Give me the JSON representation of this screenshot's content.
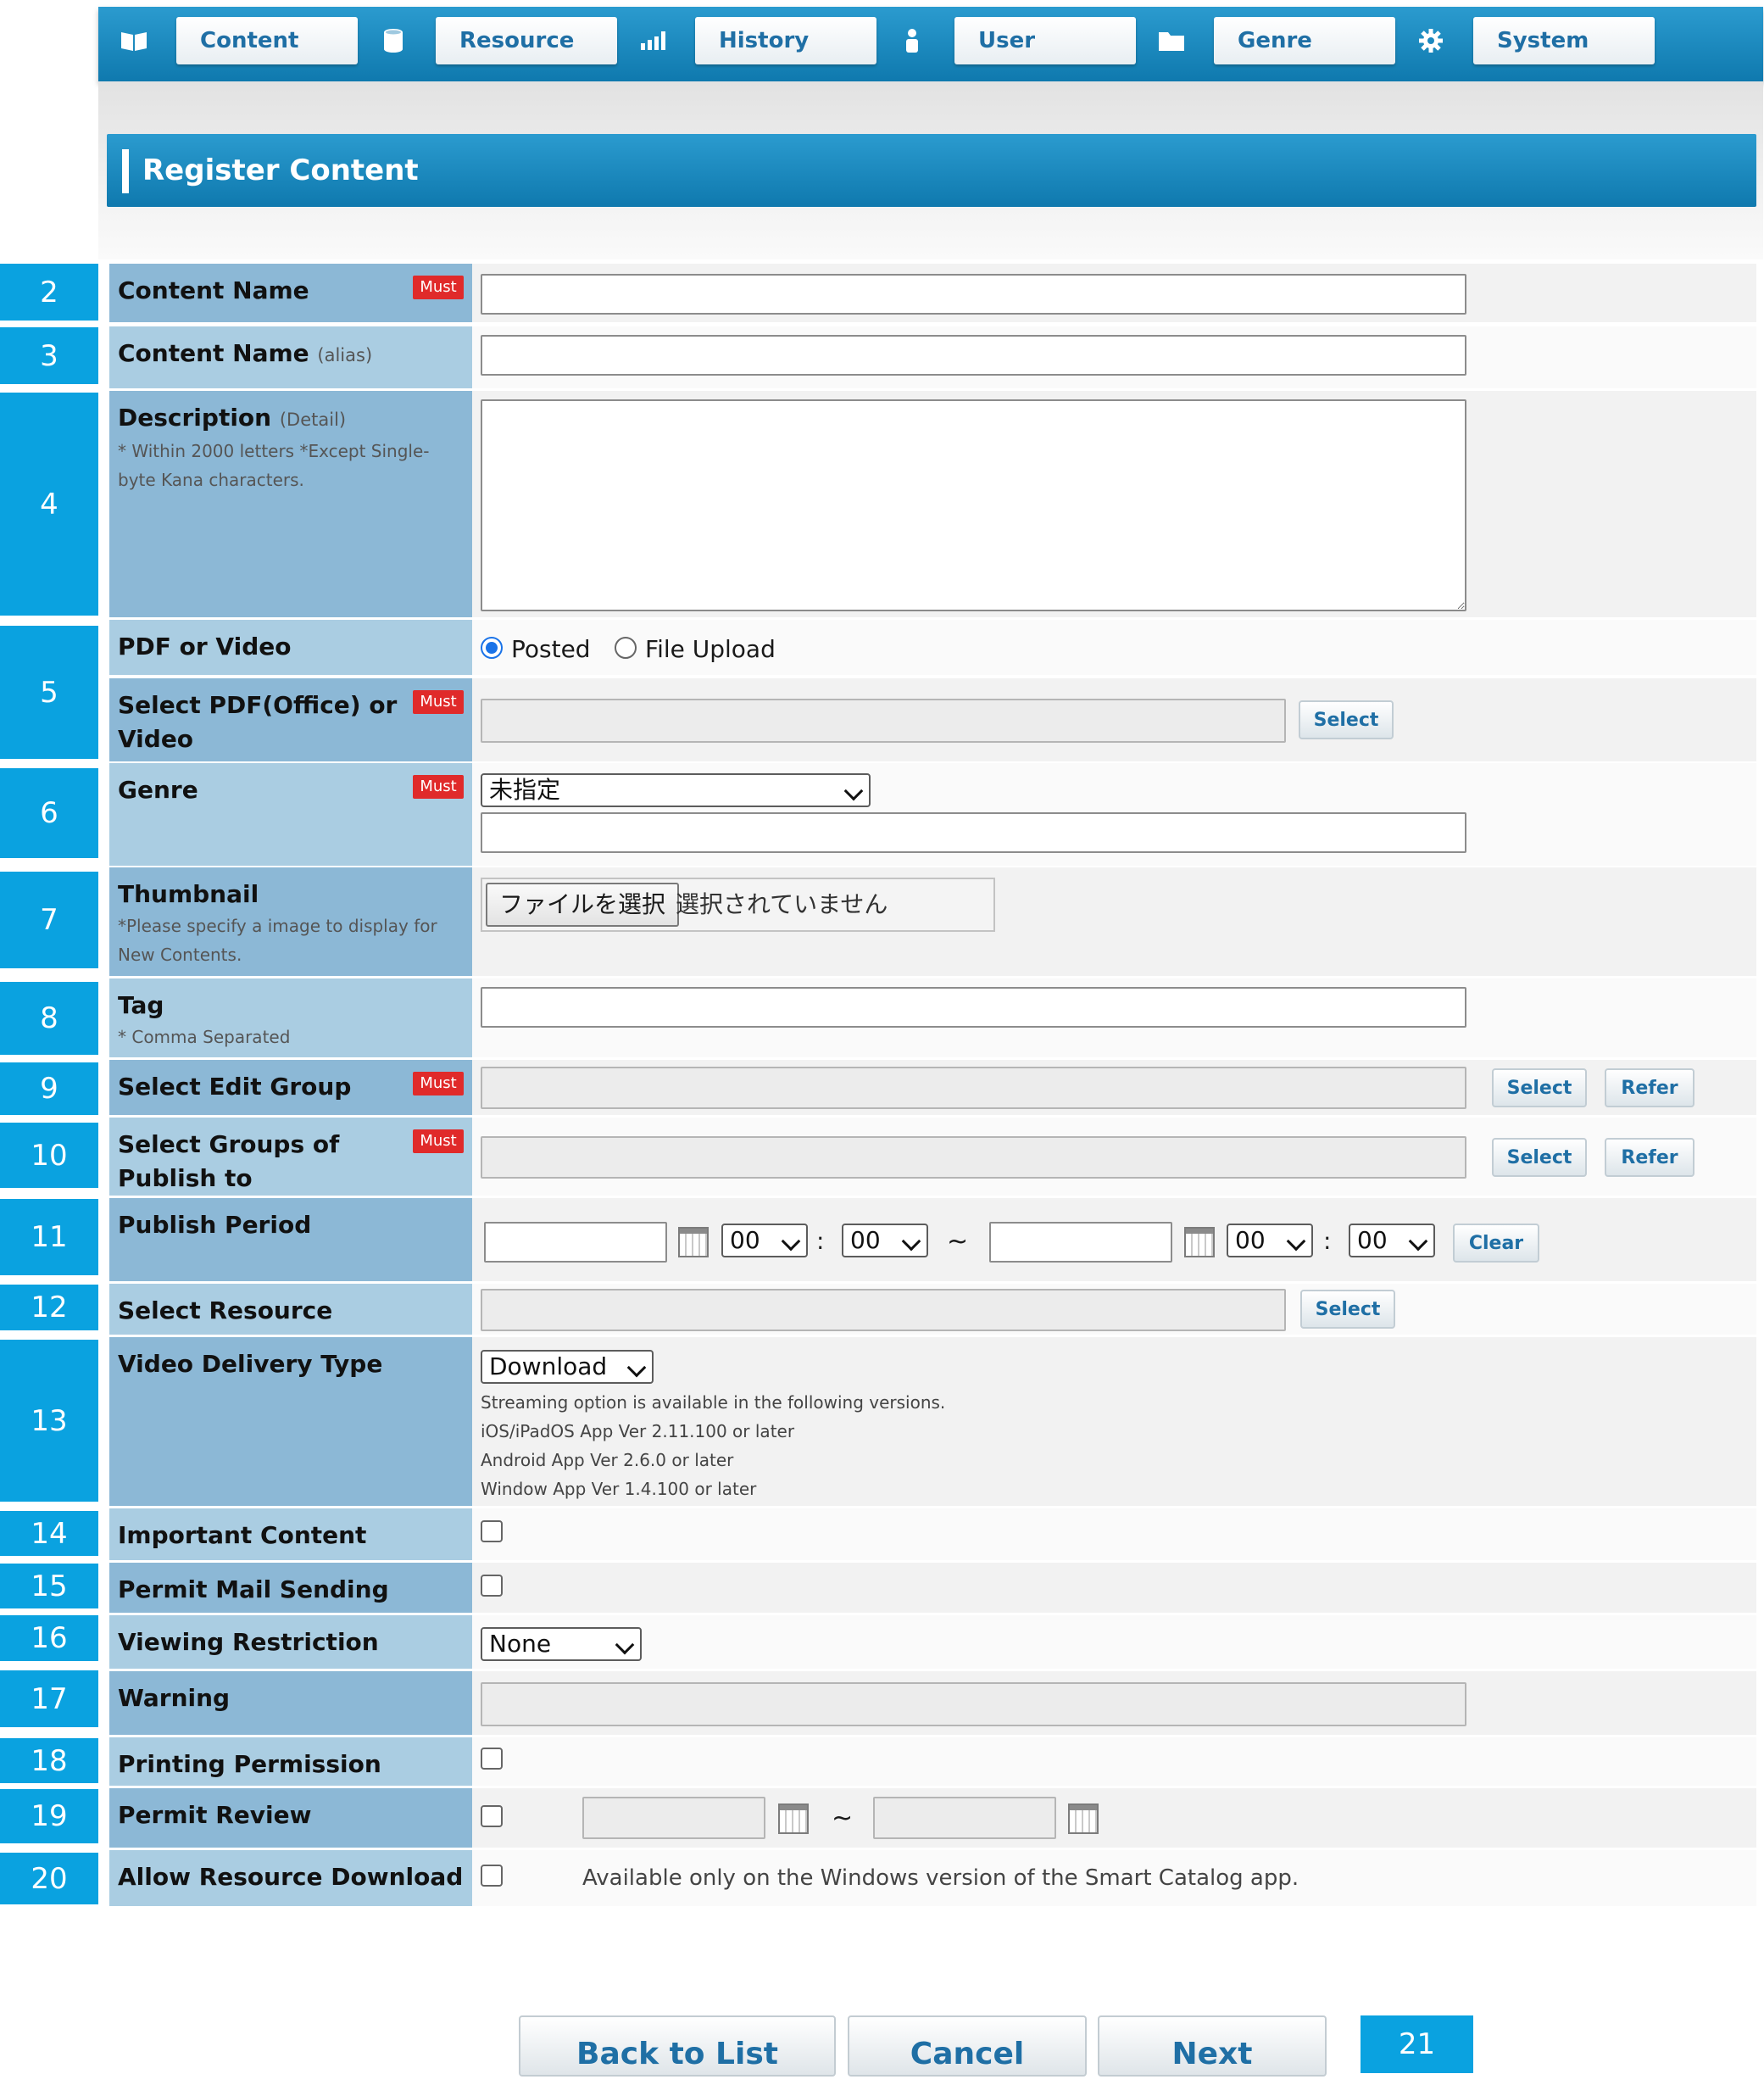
{
  "nav": [
    {
      "label": "Content",
      "icon": "book-icon"
    },
    {
      "label": "Resource",
      "icon": "database-icon"
    },
    {
      "label": "History",
      "icon": "bar-chart-icon"
    },
    {
      "label": "User",
      "icon": "user-icon"
    },
    {
      "label": "Genre",
      "icon": "folder-icon"
    },
    {
      "label": "System",
      "icon": "gear-icon"
    }
  ],
  "page_title": "Register Content",
  "must_label": "Must",
  "rows": {
    "content_name": {
      "num": "2",
      "label": "Content Name",
      "value": ""
    },
    "content_alias": {
      "num": "3",
      "label": "Content Name",
      "sub": "(alias)",
      "value": ""
    },
    "description": {
      "num": "4",
      "label": "Description",
      "sub": "(Detail)",
      "note": " * Within 2000 letters *Except Single-byte Kana characters.",
      "value": ""
    },
    "pdf_video": {
      "num": "5",
      "label": "PDF or Video",
      "option_posted": "Posted",
      "option_upload": "File Upload",
      "selected": "Posted"
    },
    "select_pdf": {
      "label": "Select PDF(Office) or Video",
      "value": "",
      "button": "Select"
    },
    "genre": {
      "num": "6",
      "label": "Genre",
      "selected": "未指定",
      "value": ""
    },
    "thumbnail": {
      "num": "7",
      "label": "Thumbnail",
      "note": " *Please specify a image to display for New Contents.",
      "file_button": "ファイルを選択",
      "file_status": "選択されていません"
    },
    "tag": {
      "num": "8",
      "label": "Tag",
      "note": " * Comma Separated",
      "value": ""
    },
    "edit_group": {
      "num": "9",
      "label": "Select Edit Group",
      "value": "",
      "select_button": "Select",
      "refer_button": "Refer"
    },
    "publish_groups": {
      "num": "10",
      "label": "Select Groups of Publish to",
      "value": "",
      "select_button": "Select",
      "refer_button": "Refer"
    },
    "publish_period": {
      "num": "11",
      "label": "Publish Period",
      "start_date": "",
      "start_hour": "00",
      "start_min": "00",
      "end_date": "",
      "end_hour": "00",
      "end_min": "00",
      "colon": ":",
      "tilde": "~",
      "clear_button": "Clear"
    },
    "resource": {
      "num": "12",
      "label": "Select Resource",
      "value": "",
      "button": "Select"
    },
    "delivery": {
      "num": "13",
      "label": "Video Delivery Type",
      "selected": "Download",
      "notes": [
        "Streaming option is available in the following versions.",
        "iOS/iPadOS App Ver 2.11.100 or later",
        "Android App Ver 2.6.0 or later",
        "Window App Ver 1.4.100 or later"
      ]
    },
    "important": {
      "num": "14",
      "label": "Important Content",
      "checked": false
    },
    "mail": {
      "num": "15",
      "label": "Permit Mail Sending",
      "checked": false
    },
    "restriction": {
      "num": "16",
      "label": "Viewing Restriction",
      "selected": "None"
    },
    "warning": {
      "num": "17",
      "label": "Warning",
      "value": ""
    },
    "printing": {
      "num": "18",
      "label": "Printing Permission",
      "checked": false
    },
    "review": {
      "num": "19",
      "label": "Permit Review",
      "checked": false,
      "start": "",
      "end": "",
      "tilde": "~"
    },
    "download": {
      "num": "20",
      "label": "Allow Resource Download",
      "checked": false,
      "note": "Available only on the Windows version of the Smart Catalog app."
    }
  },
  "footer": {
    "back": "Back to List",
    "cancel": "Cancel",
    "next": "Next",
    "num": "21"
  },
  "colors": {
    "brand_blue": "#0f79ae",
    "marker_blue": "#0aa2e0",
    "must_red": "#e02a2a",
    "label_dark": "#8cb8d6",
    "label_light": "#aacde2"
  }
}
